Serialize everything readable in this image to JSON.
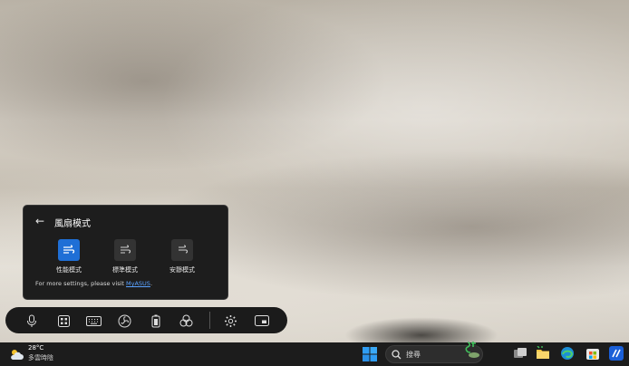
{
  "flyout": {
    "back_glyph": "←",
    "title": "風扇模式",
    "modes": [
      {
        "label": "性能模式",
        "icon": "fan-performance-icon",
        "active": true
      },
      {
        "label": "標準模式",
        "icon": "fan-standard-icon",
        "active": false
      },
      {
        "label": "安靜模式",
        "icon": "fan-whisper-icon",
        "active": false
      }
    ],
    "footer_text": "For more settings, please visit ",
    "footer_link": "MyASUS",
    "footer_end": "."
  },
  "toolbar": {
    "items": [
      "microphone-icon",
      "grid-apps-icon",
      "keyboard-icon",
      "fan-icon",
      "battery-icon",
      "color-circles-icon",
      "settings-gear-icon",
      "picture-in-picture-icon"
    ]
  },
  "taskbar": {
    "weather_temp": "28°C",
    "weather_desc": "多雲時陰",
    "search_placeholder": "搜尋",
    "colors": {
      "accent": "#1f6fd6",
      "taskbar": "#1c1c1c",
      "link": "#5aa2ff"
    }
  }
}
